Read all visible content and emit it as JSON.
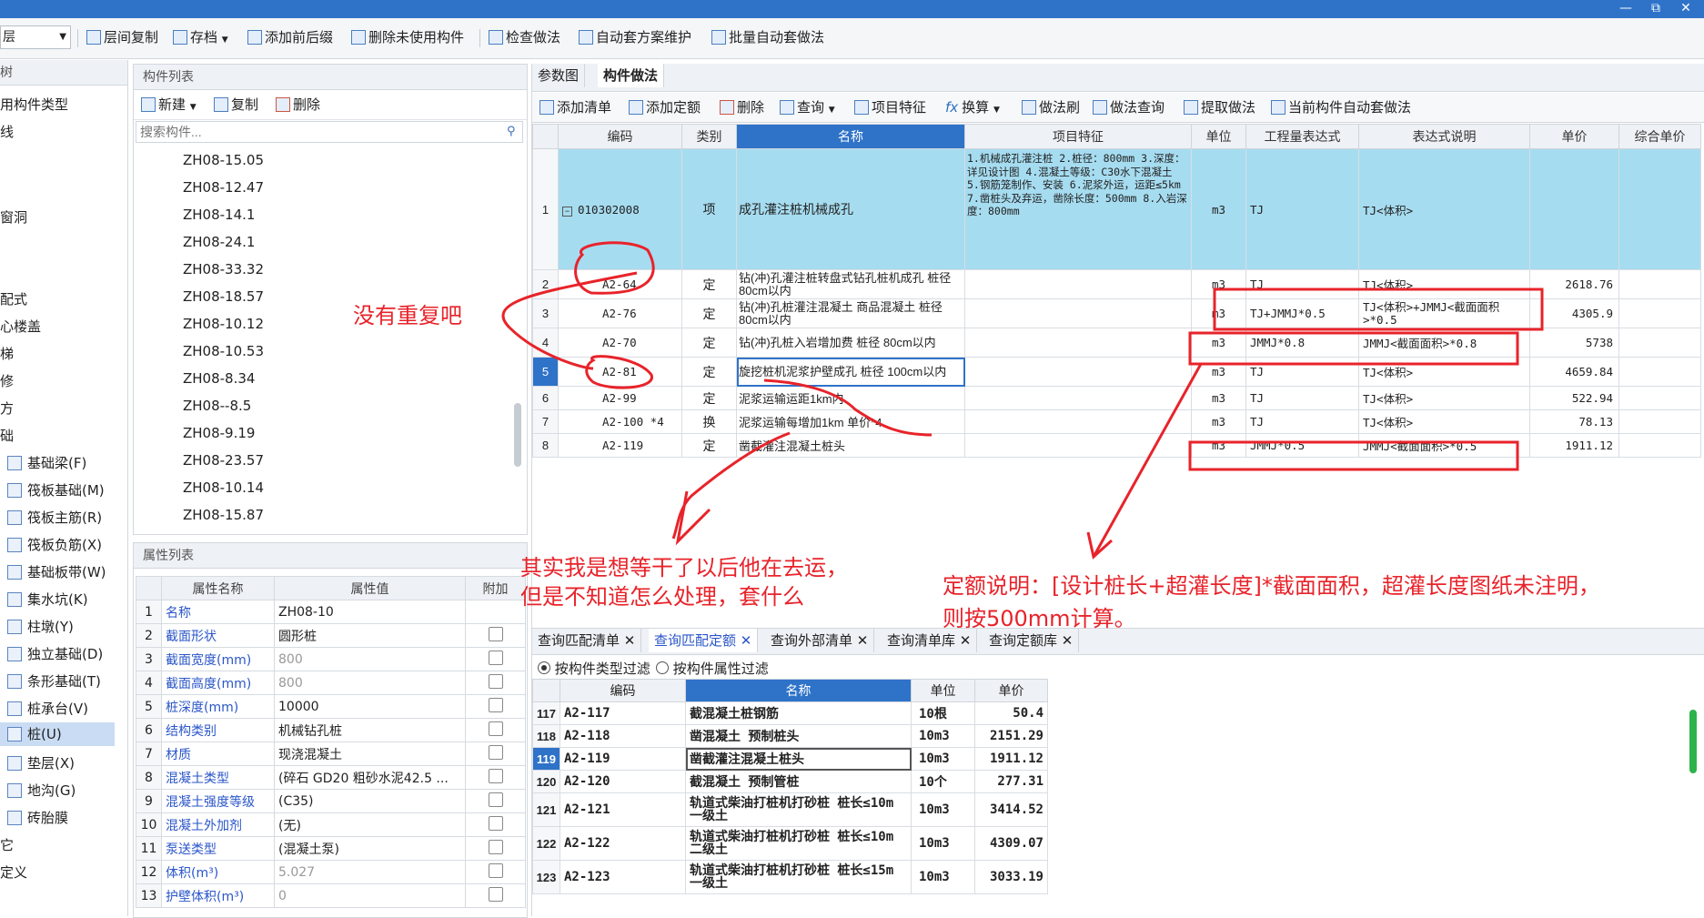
{
  "window": {
    "controls": [
      "—",
      "⧉",
      "✕"
    ]
  },
  "toolbar": {
    "combo_value": "层",
    "items": [
      "层间复制",
      "存档",
      "添加前后缀",
      "删除未使用构件",
      "检查做法",
      "自动套方案维护",
      "批量自动套做法"
    ]
  },
  "nav": {
    "header": "树",
    "items": [
      "用构件类型",
      "线",
      "窗洞",
      "配式",
      "心楼盖",
      "梯",
      "修",
      "方",
      "础",
      "基础梁(F)",
      "筏板基础(M)",
      "筏板主筋(R)",
      "筏板负筋(X)",
      "基础板带(W)",
      "集水坑(K)",
      "柱墩(Y)",
      "独立基础(D)",
      "条形基础(T)",
      "桩承台(V)",
      "桩(U)",
      "垫层(X)",
      "地沟(G)",
      "砖胎膜",
      "它",
      "定义"
    ]
  },
  "component_list": {
    "header": "构件列表",
    "toolbar": {
      "new": "新建",
      "copy": "复制",
      "delete": "删除"
    },
    "search_placeholder": "搜索构件...",
    "items": [
      "ZH08-15.05",
      "ZH08-12.47",
      "ZH08-14.1",
      "ZH08-24.1",
      "ZH08-33.32",
      "ZH08-18.57",
      "ZH08-10.12",
      "ZH08-10.53",
      "ZH08-8.34",
      "ZH08--8.5",
      "ZH08-9.19",
      "ZH08-23.57",
      "ZH08-10.14",
      "ZH08-15.87"
    ]
  },
  "property_list": {
    "header": "属性列表",
    "columns": [
      "属性名称",
      "属性值",
      "附加"
    ],
    "rows": [
      {
        "n": "1",
        "name": "名称",
        "value": "ZH08-10"
      },
      {
        "n": "2",
        "name": "截面形状",
        "value": "圆形桩"
      },
      {
        "n": "3",
        "name": "截面宽度(mm)",
        "value": "800"
      },
      {
        "n": "4",
        "name": "截面高度(mm)",
        "value": "800"
      },
      {
        "n": "5",
        "name": "桩深度(mm)",
        "value": "10000"
      },
      {
        "n": "6",
        "name": "结构类别",
        "value": "机械钻孔桩"
      },
      {
        "n": "7",
        "name": "材质",
        "value": "现浇混凝土"
      },
      {
        "n": "8",
        "name": "混凝土类型",
        "value": "(碎石 GD20 粗砂水泥42.5 ..."
      },
      {
        "n": "9",
        "name": "混凝土强度等级",
        "value": "(C35)"
      },
      {
        "n": "10",
        "name": "混凝土外加剂",
        "value": "(无)"
      },
      {
        "n": "11",
        "name": "泵送类型",
        "value": "(混凝土泵)"
      },
      {
        "n": "12",
        "name": "体积(m³)",
        "value": "5.027"
      },
      {
        "n": "13",
        "name": "护壁体积(m³)",
        "value": "0"
      }
    ]
  },
  "main": {
    "tabs": [
      "参数图",
      "构件做法"
    ],
    "toolbar": [
      "添加清单",
      "添加定额",
      "删除",
      "查询",
      "项目特征",
      "换算",
      "做法刷",
      "做法查询",
      "提取做法",
      "当前构件自动套做法"
    ],
    "columns": [
      "编码",
      "类别",
      "名称",
      "项目特征",
      "单位",
      "工程量表达式",
      "表达式说明",
      "单价",
      "综合单价"
    ],
    "rows": [
      {
        "n": "1",
        "code": "010302008",
        "type": "项",
        "name": "成孔灌注桩机械成孔",
        "feature": "1.机械成孔灌注桩 2.桩径：800mm 3.深度：详见设计图 4.混凝土等级：C30水下混凝土 5.钢筋笼制作、安装 6.泥浆外运，运距≤5km 7.凿桩头及弃运，凿除长度：500mm 8.入岩深度：800mm",
        "unit": "m3",
        "expr": "TJ",
        "desc": "TJ<体积>",
        "price": ""
      },
      {
        "n": "2",
        "code": "A2-64",
        "type": "定",
        "name": "钻(冲)孔灌注桩转盘式钻孔桩机成孔 桩径 80cm以内",
        "feature": "",
        "unit": "m3",
        "expr": "TJ",
        "desc": "TJ<体积>",
        "price": "2618.76"
      },
      {
        "n": "3",
        "code": "A2-76",
        "type": "定",
        "name": "钻(冲)孔桩灌注混凝土 商品混凝土 桩径 80cm以内",
        "feature": "",
        "unit": "m3",
        "expr": "TJ+JMMJ*0.5",
        "desc": "TJ<体积>+JMMJ<截面面积>*0.5",
        "price": "4305.9"
      },
      {
        "n": "4",
        "code": "A2-70",
        "type": "定",
        "name": "钻(冲)孔桩入岩增加费 桩径 80cm以内",
        "feature": "",
        "unit": "m3",
        "expr": "JMMJ*0.8",
        "desc": "JMMJ<截面面积>*0.8",
        "price": "5738"
      },
      {
        "n": "5",
        "code": "A2-81",
        "type": "定",
        "name": "旋挖桩机泥浆护壁成孔 桩径 100cm以内",
        "feature": "",
        "unit": "m3",
        "expr": "TJ",
        "desc": "TJ<体积>",
        "price": "4659.84"
      },
      {
        "n": "6",
        "code": "A2-99",
        "type": "定",
        "name": "泥浆运输运距1km内",
        "feature": "",
        "unit": "m3",
        "expr": "TJ",
        "desc": "TJ<体积>",
        "price": "522.94"
      },
      {
        "n": "7",
        "code": "A2-100 *4",
        "type": "换",
        "name": "泥浆运输每增加1km 单价*4",
        "feature": "",
        "unit": "m3",
        "expr": "TJ",
        "desc": "TJ<体积>",
        "price": "78.13"
      },
      {
        "n": "8",
        "code": "A2-119",
        "type": "定",
        "name": "凿截灌注混凝土桩头",
        "feature": "",
        "unit": "m3",
        "expr": "JMMJ*0.5",
        "desc": "JMMJ<截面面积>*0.5",
        "price": "1911.12"
      }
    ]
  },
  "bottom": {
    "tabs": [
      "查询匹配清单",
      "查询匹配定额",
      "查询外部清单",
      "查询清单库",
      "查询定额库"
    ],
    "filters": [
      "按构件类型过滤",
      "按构件属性过滤"
    ],
    "columns": [
      "编码",
      "名称",
      "单位",
      "单价"
    ],
    "rows": [
      {
        "n": "117",
        "code": "A2-117",
        "name": "截混凝土桩钢筋",
        "unit": "10根",
        "price": "50.4"
      },
      {
        "n": "118",
        "code": "A2-118",
        "name": "凿混凝土 预制桩头",
        "unit": "10m3",
        "price": "2151.29"
      },
      {
        "n": "119",
        "code": "A2-119",
        "name": "凿截灌注混凝土桩头",
        "unit": "10m3",
        "price": "1911.12"
      },
      {
        "n": "120",
        "code": "A2-120",
        "name": "截混凝土 预制管桩",
        "unit": "10个",
        "price": "277.31"
      },
      {
        "n": "121",
        "code": "A2-121",
        "name": "轨道式柴油打桩机打砂桩 桩长≤10m 一级土",
        "unit": "10m3",
        "price": "3414.52"
      },
      {
        "n": "122",
        "code": "A2-122",
        "name": "轨道式柴油打桩机打砂桩 桩长≤10m 二级土",
        "unit": "10m3",
        "price": "4309.07"
      },
      {
        "n": "123",
        "code": "A2-123",
        "name": "轨道式柴油打桩机打砂桩 桩长≤15m 一级土",
        "unit": "10m3",
        "price": "3033.19"
      }
    ]
  },
  "annotations": {
    "a1": "没有重复吧",
    "a2_line1": "其实我是想等干了以后他在去运，",
    "a2_line2": "但是不知道怎么处理，套什么",
    "a3_line1": "定额说明：[设计桩长+超灌长度]*截面面积，超灌长度图纸未注明，",
    "a3_line2": "则按500mm计算。"
  },
  "colors": {
    "accent": "#2f73c9",
    "selected_row": "#a6dcf0",
    "annotation": "#e8232a"
  }
}
